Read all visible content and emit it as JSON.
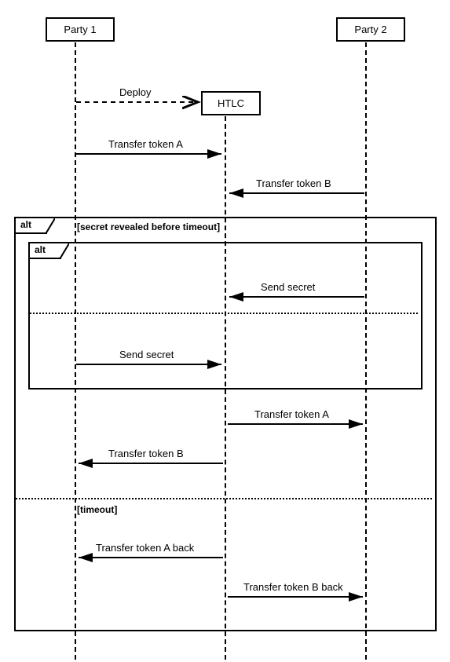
{
  "participants": {
    "party1": "Party 1",
    "htlc": "HTLC",
    "party2": "Party 2"
  },
  "messages": {
    "deploy": "Deploy",
    "transfer_a": "Transfer token A",
    "transfer_b": "Transfer token B",
    "send_secret_p2": "Send secret",
    "send_secret_p1": "Send secret",
    "transfer_a_out": "Transfer token A",
    "transfer_b_out": "Transfer token B",
    "transfer_a_back": "Transfer token A back",
    "transfer_b_back": "Transfer token B back"
  },
  "frames": {
    "outer_label": "alt",
    "outer_guard": "[secret revealed before timeout]",
    "inner_label": "alt",
    "timeout_guard": "[timeout]"
  },
  "chart_data": {
    "type": "sequence-diagram",
    "participants": [
      "Party 1",
      "HTLC",
      "Party 2"
    ],
    "messages": [
      {
        "from": "Party 1",
        "to": "HTLC",
        "label": "Deploy",
        "style": "dashed",
        "creates": "HTLC"
      },
      {
        "from": "Party 1",
        "to": "HTLC",
        "label": "Transfer token A",
        "style": "solid"
      },
      {
        "from": "Party 2",
        "to": "HTLC",
        "label": "Transfer token B",
        "style": "solid"
      },
      {
        "fragment": "alt",
        "guard": "secret revealed before timeout",
        "children": [
          {
            "fragment": "alt",
            "children": [
              {
                "from": "Party 2",
                "to": "HTLC",
                "label": "Send secret",
                "style": "solid"
              },
              {
                "divider": true
              },
              {
                "from": "Party 1",
                "to": "HTLC",
                "label": "Send secret",
                "style": "solid"
              }
            ]
          },
          {
            "from": "HTLC",
            "to": "Party 2",
            "label": "Transfer token A",
            "style": "solid"
          },
          {
            "from": "HTLC",
            "to": "Party 1",
            "label": "Transfer token B",
            "style": "solid"
          },
          {
            "divider": true,
            "guard": "timeout"
          },
          {
            "from": "HTLC",
            "to": "Party 1",
            "label": "Transfer token A back",
            "style": "solid"
          },
          {
            "from": "HTLC",
            "to": "Party 2",
            "label": "Transfer token B back",
            "style": "solid"
          }
        ]
      }
    ]
  }
}
